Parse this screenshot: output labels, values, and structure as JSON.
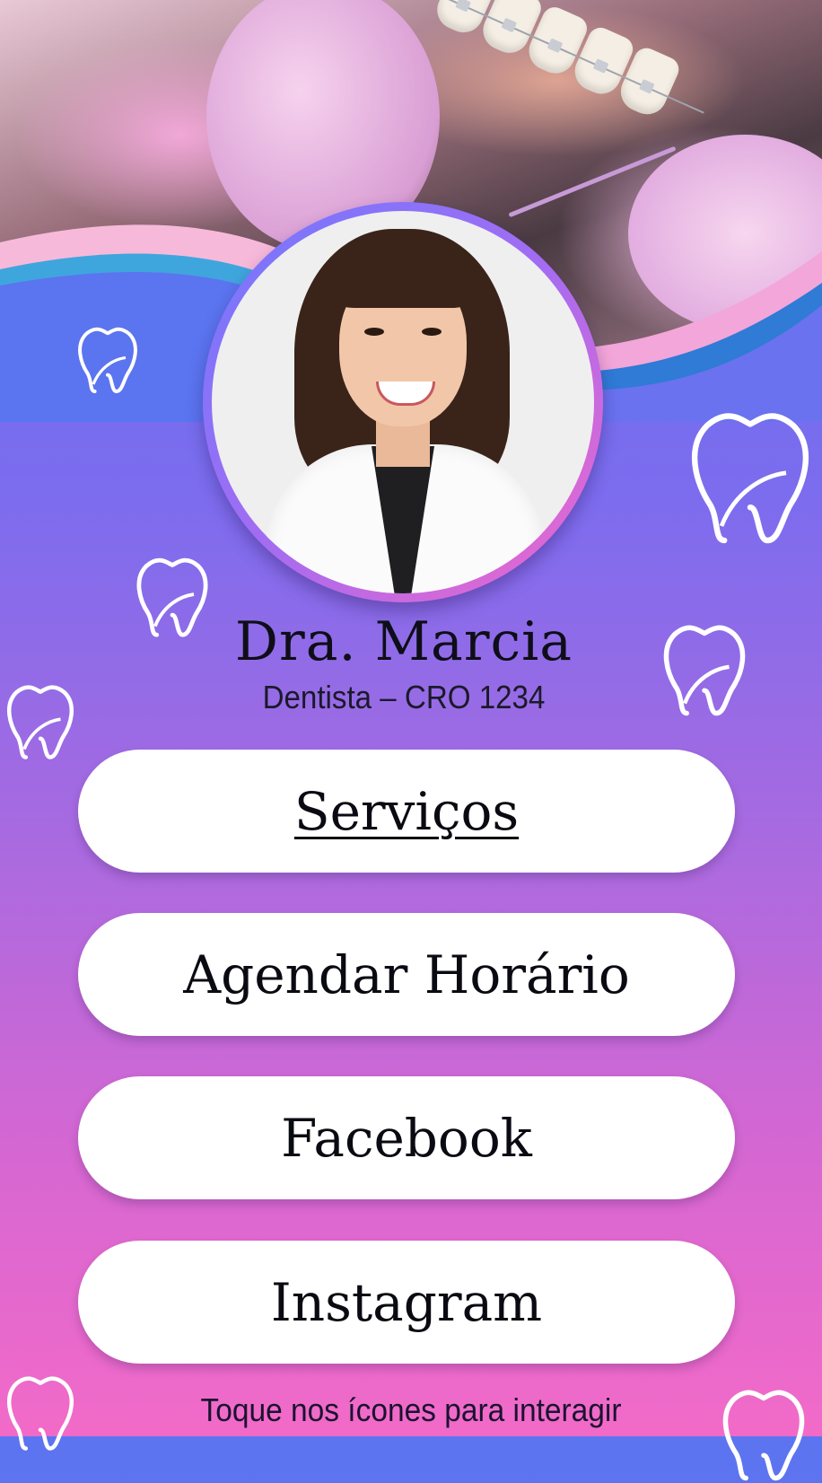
{
  "profile": {
    "name": "Dra. Marcia",
    "subtitle": "Dentista – CRO 1234"
  },
  "links": [
    {
      "label": "Serviços"
    },
    {
      "label": "Agendar Horário"
    },
    {
      "label": "Facebook"
    },
    {
      "label": "Instagram"
    }
  ],
  "footer": {
    "hint": "Toque nos ícones para interagir"
  },
  "colors": {
    "gradient_top": "#5b74f0",
    "gradient_bottom": "#f26ac8",
    "button_bg": "#ffffff",
    "text": "#0e0e18"
  },
  "icons": [
    "tooth-icon"
  ]
}
